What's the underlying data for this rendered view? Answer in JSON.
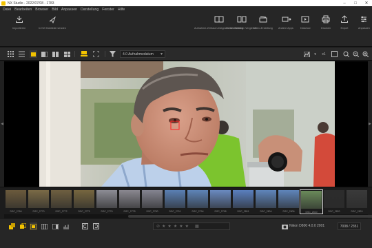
{
  "window": {
    "title": "NX Studio - 2022/07/08 - 1783",
    "minimize_icon": "minimize-icon",
    "maximize_icon": "maximize-icon",
    "close_icon": "close-icon"
  },
  "menu": [
    "Datei",
    "Bearbeiten",
    "Browser",
    "Bild",
    "Anpassen",
    "Darstellung",
    "Fenster",
    "Hilfe"
  ],
  "toolbar": {
    "left": [
      {
        "label": "Importieren",
        "icon": "import-icon"
      },
      {
        "label": "In NX MobileAir senden",
        "icon": "send-icon"
      }
    ],
    "right": [
      {
        "label": "Aufnahme-Zeitraum-Diagrammdarstellung",
        "icon": "compare-icon"
      },
      {
        "label": "Vorher-Nachher-Vergleich",
        "icon": "before-after-icon"
      },
      {
        "label": "Video-Erstellung",
        "icon": "movie-editor-icon"
      },
      {
        "label": "Andere Apps",
        "icon": "other-apps-icon"
      },
      {
        "label": "Diashow",
        "icon": "slideshow-icon"
      },
      {
        "label": "Drucken",
        "icon": "print-icon"
      },
      {
        "label": "Export",
        "icon": "export-icon"
      },
      {
        "label": "Anpassen",
        "icon": "adjust-icon"
      }
    ]
  },
  "viewbar": {
    "filter_value": "4.0 Aufnahmedatum",
    "zoom_label": "x1",
    "colors": {
      "accent": "#f3c300"
    }
  },
  "filmstrip": {
    "thumbs": [
      {
        "caption": "DSC_2766",
        "color": "#6b5a3c"
      },
      {
        "caption": "DSC_2770",
        "color": "#7a6a46"
      },
      {
        "caption": "DSC_2772",
        "color": "#6e5f40"
      },
      {
        "caption": "DSC_2775",
        "color": "#76663f"
      },
      {
        "caption": "DSC_2776",
        "color": "#8c8c94"
      },
      {
        "caption": "DSC_2778",
        "color": "#8a8890"
      },
      {
        "caption": "DSC_2780",
        "color": "#848490"
      },
      {
        "caption": "DSC_2791",
        "color": "#5a7fb3"
      },
      {
        "caption": "DSC_2794",
        "color": "#5e84b8"
      },
      {
        "caption": "DSC_2798",
        "color": "#6a8ac0"
      },
      {
        "caption": "DSC_2801",
        "color": "#5a7fbe"
      },
      {
        "caption": "DSC_2804",
        "color": "#5f85bb"
      },
      {
        "caption": "DSC_2806",
        "color": "#5f85bb"
      },
      {
        "caption": "DSC_2810",
        "color": "#6a8a5a"
      },
      {
        "caption": "DSC_2820",
        "color": "#2c2c2c"
      },
      {
        "caption": "DSC_2824",
        "color": "#3a3a3a"
      }
    ],
    "selected_index": 13
  },
  "status": {
    "camera_info": "Nikon D800 4.0.0 2001",
    "zoom": "7008 / 2351",
    "rating_stars": 5
  }
}
